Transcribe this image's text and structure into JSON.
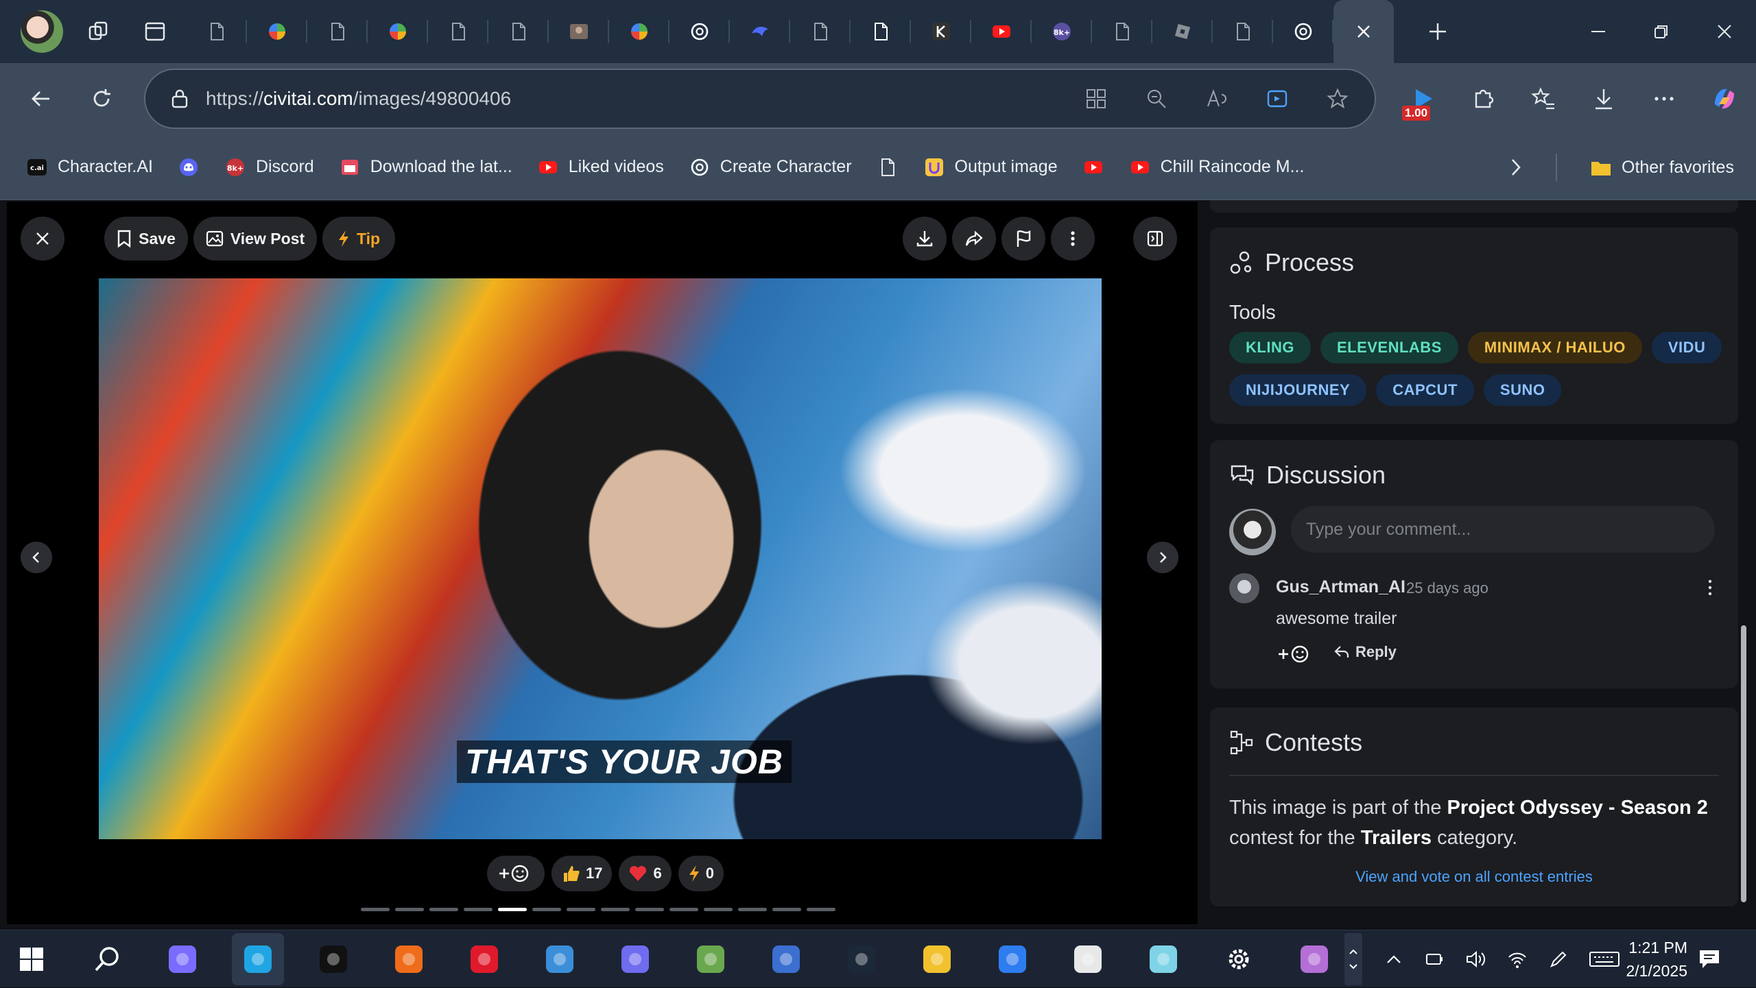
{
  "browser": {
    "url_prefix": "https://",
    "url_host": "civitai.com",
    "url_path": "/images/49800406",
    "extension_badge": "1.00",
    "tabs": [
      {
        "icon": "page-icon",
        "color": "#9aa3ad"
      },
      {
        "icon": "pinwheel-icon",
        "color": "#6fcf6a"
      },
      {
        "icon": "page-icon",
        "color": "#9aa3ad"
      },
      {
        "icon": "pinwheel-icon",
        "color": "#6fcf6a"
      },
      {
        "icon": "page-icon",
        "color": "#9aa3ad"
      },
      {
        "icon": "page-icon",
        "color": "#9aa3ad"
      },
      {
        "icon": "thumbnail-icon",
        "color": "#7a6a62"
      },
      {
        "icon": "pinwheel-icon",
        "color": "#6fcf6a"
      },
      {
        "icon": "openai-icon",
        "color": "#ffffff"
      },
      {
        "icon": "bird-icon",
        "color": "#4d6bff"
      },
      {
        "icon": "page-icon",
        "color": "#9aa3ad"
      },
      {
        "icon": "page-icon",
        "color": "#ffffff"
      },
      {
        "icon": "k-icon",
        "color": "#333333"
      },
      {
        "icon": "youtube-icon",
        "color": "#ff1a1a"
      },
      {
        "icon": "8k-icon",
        "color": "#5a4fa0"
      },
      {
        "icon": "page-icon",
        "color": "#9aa3ad"
      },
      {
        "icon": "roblox-icon",
        "color": "#8a8f96"
      },
      {
        "icon": "page-icon",
        "color": "#9aa3ad"
      },
      {
        "icon": "openai-icon",
        "color": "#ffffff"
      },
      {
        "icon": "close-icon",
        "color": "#ffffff",
        "active": true
      }
    ]
  },
  "favorites": [
    {
      "label": "Character.AI",
      "icon": "cai-icon",
      "color": "#111111"
    },
    {
      "label": "",
      "icon": "discord-icon",
      "color": "#5865f2"
    },
    {
      "label": "Discord",
      "icon": "8k-icon",
      "color": "#c8343a"
    },
    {
      "label": "Download the lat...",
      "icon": "download-site-icon",
      "color": "#e84a5f"
    },
    {
      "label": "Liked videos",
      "icon": "youtube-icon",
      "color": "#ff1a1a"
    },
    {
      "label": "Create Character",
      "icon": "openai-icon",
      "color": "#ffffff"
    },
    {
      "label": "",
      "icon": "page-icon",
      "color": "#3c4a5c"
    },
    {
      "label": "Output image",
      "icon": "u-icon",
      "color": "#f5c542"
    },
    {
      "label": "",
      "icon": "youtube-icon",
      "color": "#ff1a1a"
    },
    {
      "label": "Chill Raincode M...",
      "icon": "youtube-icon",
      "color": "#ff1a1a"
    }
  ],
  "other_favorites": "Other favorites",
  "viewer": {
    "close": "",
    "save_label": "Save",
    "view_post_label": "View Post",
    "tip_label": "Tip",
    "subtitle": "THAT'S YOUR JOB",
    "reactions": [
      {
        "icon": "add-emoji-icon",
        "count": ""
      },
      {
        "icon": "thumbs-up-icon",
        "count": "17"
      },
      {
        "icon": "heart-icon",
        "count": "6"
      },
      {
        "icon": "lightning-icon",
        "count": "0"
      }
    ],
    "pager": {
      "total": 14,
      "active": 4
    }
  },
  "process": {
    "title": "Process",
    "tools_label": "Tools",
    "tools": [
      {
        "label": "KLING",
        "style": "teal"
      },
      {
        "label": "ELEVENLABS",
        "style": "teal"
      },
      {
        "label": "MINIMAX / HAILUO",
        "style": "gold"
      },
      {
        "label": "VIDU",
        "style": "blue"
      },
      {
        "label": "NIJIJOURNEY",
        "style": "blue"
      },
      {
        "label": "CAPCUT",
        "style": "blue"
      },
      {
        "label": "SUNO",
        "style": "blue"
      }
    ]
  },
  "discussion": {
    "title": "Discussion",
    "input_placeholder": "Type your comment...",
    "comment": {
      "user": "Gus_Artman_AI",
      "time": "25 days ago",
      "body": "awesome trailer",
      "reply_label": "Reply"
    }
  },
  "contests": {
    "title": "Contests",
    "text_1": "This image is part of the ",
    "contest_name": "Project Odyssey - Season 2",
    "text_2": " contest for the ",
    "category": "Trailers",
    "text_3": " category.",
    "link": "View and vote on all contest entries"
  },
  "taskbar": {
    "apps": [
      {
        "name": "start",
        "color": "#ffffff"
      },
      {
        "name": "search",
        "color": "#ffffff"
      },
      {
        "name": "copilot",
        "color": "#7b6cff"
      },
      {
        "name": "edge",
        "color": "#1fa5e3",
        "active": true
      },
      {
        "name": "tiktok",
        "color": "#111111"
      },
      {
        "name": "clicker",
        "color": "#ef6c1a"
      },
      {
        "name": "opera",
        "color": "#e01a2b"
      },
      {
        "name": "scissors",
        "color": "#3b8fd9"
      },
      {
        "name": "discord",
        "color": "#6f6cf0"
      },
      {
        "name": "minecraft",
        "color": "#6aa84f"
      },
      {
        "name": "photos",
        "color": "#3b6fd0"
      },
      {
        "name": "steam",
        "color": "#1b2838"
      },
      {
        "name": "file-explorer",
        "color": "#f2c12e"
      },
      {
        "name": "store",
        "color": "#2e7df0"
      },
      {
        "name": "roblox",
        "color": "#e8e8e8"
      },
      {
        "name": "notes",
        "color": "#7fd3e6"
      },
      {
        "name": "settings",
        "color": "#ffffff"
      },
      {
        "name": "anime-app",
        "color": "#b46fd6"
      }
    ],
    "time": "1:21 PM",
    "date": "2/1/2025"
  }
}
